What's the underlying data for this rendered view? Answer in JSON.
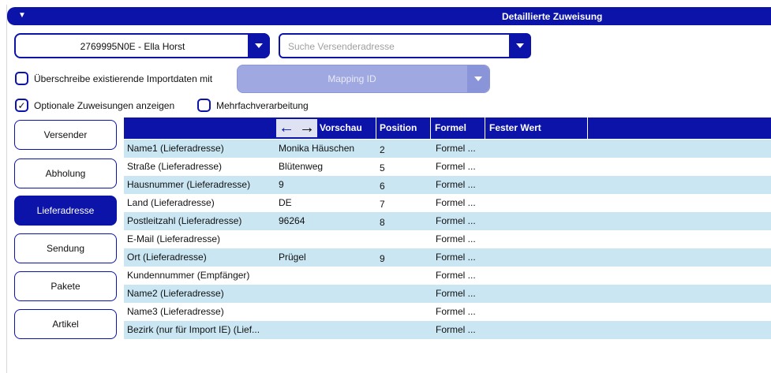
{
  "header": {
    "title": "Detaillierte Zuweisung"
  },
  "sender_select": {
    "value": "2769995N0E - Ella Horst"
  },
  "sender_search": {
    "placeholder": "Suche Versenderadresse"
  },
  "overwrite_option": {
    "label": "Überschreibe existierende Importdaten mit",
    "checked": false
  },
  "mapping_select": {
    "value": "Mapping ID"
  },
  "optional_option": {
    "label": "Optionale Zuweisungen anzeigen",
    "checked": true,
    "mark": "✓"
  },
  "multi_option": {
    "label": "Mehrfachverarbeitung",
    "checked": false
  },
  "categories": [
    {
      "label": "Versender"
    },
    {
      "label": "Abholung"
    },
    {
      "label": "Lieferadresse",
      "active": true
    },
    {
      "label": "Sendung"
    },
    {
      "label": "Pakete"
    },
    {
      "label": "Artikel"
    }
  ],
  "table": {
    "columns": {
      "preview": "Vorschau",
      "position": "Position",
      "formula": "Formel",
      "fixed": "Fester Wert"
    },
    "rows": [
      {
        "field": "Name1 (Lieferadresse)",
        "preview": "Monika Häuschen",
        "position": "2",
        "formula": "Formel ..."
      },
      {
        "field": "Straße (Lieferadresse)",
        "preview": "Blütenweg",
        "position": "5",
        "formula": "Formel ..."
      },
      {
        "field": "Hausnummer (Lieferadresse)",
        "preview": "9",
        "position": "6",
        "formula": "Formel ..."
      },
      {
        "field": "Land (Lieferadresse)",
        "preview": "DE",
        "position": "7",
        "formula": "Formel ..."
      },
      {
        "field": "Postleitzahl (Lieferadresse)",
        "preview": "96264",
        "position": "8",
        "formula": "Formel ..."
      },
      {
        "field": "E-Mail (Lieferadresse)",
        "preview": "",
        "position": "",
        "formula": "Formel ..."
      },
      {
        "field": "Ort (Lieferadresse)",
        "preview": "Prügel",
        "position": "9",
        "formula": "Formel ..."
      },
      {
        "field": "Kundennummer (Empfänger)",
        "preview": "",
        "position": "",
        "formula": "Formel ..."
      },
      {
        "field": "Name2 (Lieferadresse)",
        "preview": "",
        "position": "",
        "formula": "Formel ..."
      },
      {
        "field": "Name3 (Lieferadresse)",
        "preview": "",
        "position": "",
        "formula": "Formel ..."
      },
      {
        "field": "Bezirk (nur für Import IE) (Lief...",
        "preview": "",
        "position": "",
        "formula": "Formel ..."
      }
    ]
  },
  "colors": {
    "primary": "#0b13a8",
    "row_alt": "#c9e6f2",
    "disabled": "#9fa8e0"
  }
}
